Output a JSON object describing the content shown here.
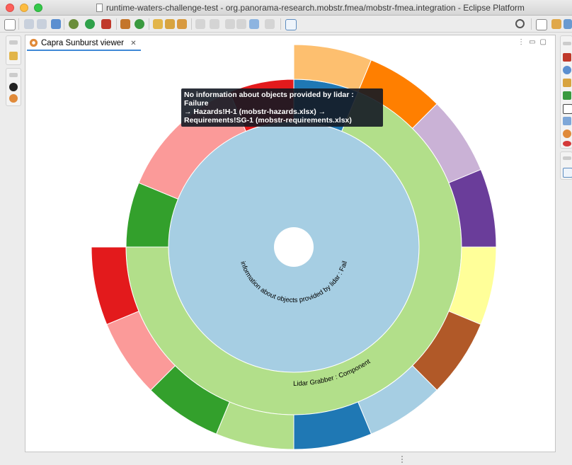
{
  "window": {
    "title": "runtime-waters-challenge-test - org.panorama-research.mobstr.fmea/mobstr-fmea.integration - Eclipse Platform"
  },
  "editor": {
    "tab_label": "Capra Sunburst viewer",
    "tab_close": "✕"
  },
  "tooltip": {
    "line1": "No information about objects provided by lidar : Failure",
    "line2": "→ Hazards!H-1 (mobstr-hazards.xlsx) →",
    "line3": "Requirements!SG-1 (mobstr-requirements.xlsx)"
  },
  "chart_data": {
    "type": "sunburst",
    "center_labels": {
      "inner": "No information about objects provided by lidar : Failure",
      "middle": "Lidar Grabber : Component"
    },
    "rings": [
      {
        "level": 1,
        "segments": [
          {
            "name": "No information about objects provided by lidar : Failure",
            "fraction": 1.0,
            "color": "#a6cee3"
          }
        ]
      },
      {
        "level": 2,
        "segments": [
          {
            "fraction": 0.0625,
            "color": "#1f78b4"
          },
          {
            "fraction": 0.6875,
            "color": "#b2df8a",
            "name": "Lidar Grabber : Component"
          },
          {
            "fraction": 0.0625,
            "color": "#33a02c"
          },
          {
            "fraction": 0.125,
            "color": "#fb9a99"
          },
          {
            "fraction": 0.0625,
            "color": "#e31a1c"
          }
        ]
      },
      {
        "level": 3,
        "segments": [
          {
            "fraction": 0.0625,
            "color": "#fdbf6f"
          },
          {
            "fraction": 0.0625,
            "color": "#ff7f00"
          },
          {
            "fraction": 0.0625,
            "color": "#cab2d6"
          },
          {
            "fraction": 0.0625,
            "color": "#6a3d9a"
          },
          {
            "fraction": 0.0625,
            "color": "#ffff99"
          },
          {
            "fraction": 0.0625,
            "color": "#b15928"
          },
          {
            "fraction": 0.0625,
            "color": "#a6cee3"
          },
          {
            "fraction": 0.0625,
            "color": "#1f78b4"
          },
          {
            "fraction": 0.0625,
            "color": "#b2df8a"
          },
          {
            "fraction": 0.0625,
            "color": "#33a02c"
          },
          {
            "fraction": 0.0625,
            "color": "#fb9a99"
          },
          {
            "fraction": 0.0625,
            "color": "#e31a1c"
          }
        ]
      }
    ]
  },
  "icons": {
    "toolbar": [
      "new-icon",
      "save-icon",
      "save-all-icon",
      "link-icon",
      "debug-icon",
      "run-icon",
      "run-external-icon",
      "new-package-icon",
      "new-class-icon",
      "open-folder-icon",
      "open-type-icon",
      "annotation-icon",
      "back-icon",
      "forward-icon",
      "open-console-icon",
      "search-icon",
      "perspective-icon",
      "java-perspective-icon"
    ]
  }
}
